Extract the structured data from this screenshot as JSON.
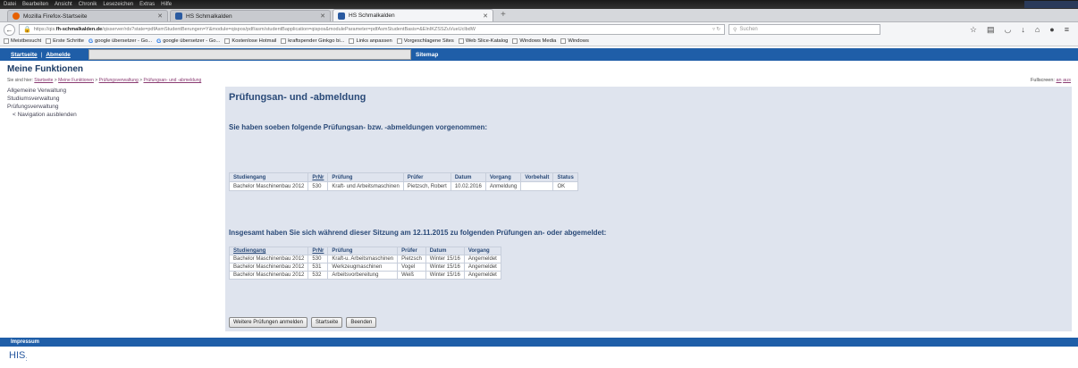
{
  "browser": {
    "menu": [
      "Datei",
      "Bearbeiten",
      "Ansicht",
      "Chronik",
      "Lesezeichen",
      "Extras",
      "Hilfe"
    ],
    "tabs": [
      {
        "label": "Mozilla Firefox-Startseite",
        "color": "#e66000"
      },
      {
        "label": "HS Schmalkalden",
        "color": "#2a5aa0"
      },
      {
        "label": "HS Schmalkalden",
        "color": "#2a5aa0"
      }
    ],
    "url_prefix": "https://qis.",
    "url_domain": "fh-schmalkalden.de",
    "url_rest": "/qisserver/rds?state=pdfAsmStudentBerungen=Y&module=qispos/pdf/asm/studentBapplication=qispos&moduleParameter=pdfAsmStudentBasis=&ElnIKZSSZuVueUclbdW",
    "search_placeholder": "Suchen",
    "bookmarks": [
      {
        "label": "Meistbesucht",
        "icon": "folder-icon"
      },
      {
        "label": "Erste Schritte",
        "icon": "page-icon"
      },
      {
        "label": "google übersetzer - Go...",
        "icon": "google-icon"
      },
      {
        "label": "google übersetzer - Go...",
        "icon": "google-icon"
      },
      {
        "label": "Kostenlose Hotmail",
        "icon": "page-icon"
      },
      {
        "label": "kraftspender Ginkgo bi...",
        "icon": "page-icon"
      },
      {
        "label": "Links anpassen",
        "icon": "page-icon"
      },
      {
        "label": "Vorgeschlagene Sites",
        "icon": "page-icon"
      },
      {
        "label": "Web Slice-Katalog",
        "icon": "page-icon"
      },
      {
        "label": "Windows Media",
        "icon": "page-icon"
      },
      {
        "label": "Windows",
        "icon": "page-icon"
      }
    ]
  },
  "hisnav": {
    "start": "Startseite",
    "sep": "|",
    "logout": "Abmelde",
    "sitemap": "Sitemap"
  },
  "page": {
    "heading": "Meine Funktionen",
    "crumb_prefix": "Sie sind hier:",
    "crumbs": [
      "Startseite",
      "Meine Funktionen",
      "Prüfungsverwaltung",
      "Prüfungsan- und -abmeldung"
    ],
    "crumb_sep": " > ",
    "fullscreen_label": "Fullscreen:",
    "fullscreen_on": "an",
    "fullscreen_off": "aus"
  },
  "leftnav": [
    "Allgemeine Verwaltung",
    "Studiumsverwaltung",
    "Prüfungsverwaltung"
  ],
  "leftnav_hide": "< Navigation ausblenden",
  "content": {
    "title": "Prüfungsan- und -abmeldung",
    "section1": "Sie haben soeben folgende Prüfungsan- bzw. -abmeldungen vorgenommen:",
    "table1": {
      "headers": [
        "Studiengang",
        "PrNr",
        "Prüfung",
        "Prüfer",
        "Datum",
        "Vorgang",
        "Vorbehalt",
        "Status"
      ],
      "rows": [
        [
          "Bachelor Maschinenbau 2012",
          "530",
          "Kraft- und Arbeitsmaschinen",
          "Pietzsch, Robert",
          "10.02.2016",
          "Anmeldung",
          "",
          "OK"
        ]
      ]
    },
    "section2": "Insgesamt haben Sie sich während dieser Sitzung am 12.11.2015 zu folgenden Prüfungen an- oder abgemeldet:",
    "table2": {
      "headers": [
        "Studiengang",
        "PrNr",
        "Prüfung",
        "Prüfer",
        "Datum",
        "Vorgang"
      ],
      "rows": [
        [
          "Bachelor Maschinenbau 2012",
          "530",
          "Kraft-u. Arbeitsmaschinen",
          "Pietzsch",
          "Winter 15/16",
          "Angemeldet"
        ],
        [
          "Bachelor Maschinenbau 2012",
          "531",
          "Werkzeugmaschinen",
          "Vogel",
          "Winter 15/16",
          "Angemeldet"
        ],
        [
          "Bachelor Maschinenbau 2012",
          "532",
          "Arbeitsvorbereitung",
          "Weiß",
          "Winter 15/16",
          "Angemeldet"
        ]
      ]
    },
    "buttons": [
      "Weitere Prüfungen anmelden",
      "Startseite",
      "Beenden"
    ]
  },
  "footer": {
    "impressum": "Impressum",
    "logo": "HIS"
  }
}
